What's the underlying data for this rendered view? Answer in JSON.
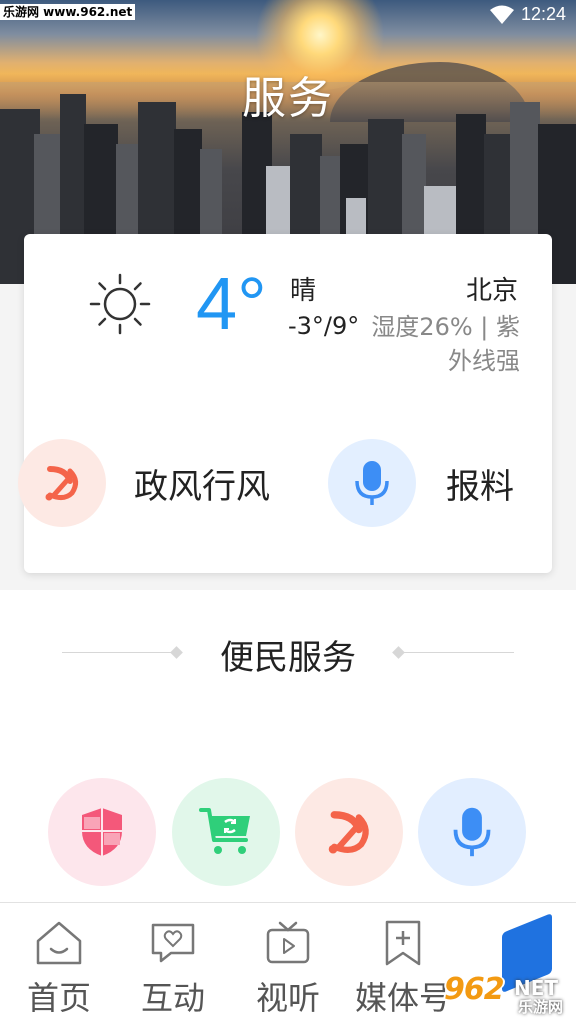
{
  "status_bar": {
    "watermark": "乐游网 www.962.net",
    "time": "12:24"
  },
  "header": {
    "title": "服务"
  },
  "weather": {
    "temperature": "4°",
    "condition": "晴",
    "city": "北京",
    "range": "-3°/9°",
    "humidity_uv": "湿度26% | 紫外线强",
    "icon": "sun-icon"
  },
  "quick_actions": [
    {
      "label": "政风行风",
      "icon": "party-emblem-icon",
      "color": "#f4644a"
    },
    {
      "label": "报料",
      "icon": "microphone-icon",
      "color": "#3d8ef5"
    }
  ],
  "convenience": {
    "title": "便民服务",
    "services": [
      {
        "icon": "shield-icon",
        "color": "#f4587a"
      },
      {
        "icon": "cart-refresh-icon",
        "color": "#2fcf7a"
      },
      {
        "icon": "party-emblem-icon",
        "color": "#f4644a"
      },
      {
        "icon": "microphone-icon",
        "color": "#3d8ef5"
      }
    ]
  },
  "bottom_nav": {
    "items": [
      {
        "label": "首页",
        "icon": "home-icon"
      },
      {
        "label": "互动",
        "icon": "chat-heart-icon"
      },
      {
        "label": "视听",
        "icon": "tv-play-icon"
      },
      {
        "label": "媒体号",
        "icon": "bookmark-plus-icon"
      }
    ]
  },
  "site_watermark": {
    "number": "962",
    "suffix": "NET",
    "name": "乐游网"
  },
  "colors": {
    "accent_blue": "#2196f3",
    "nav_active_blue": "#1f72e0"
  }
}
